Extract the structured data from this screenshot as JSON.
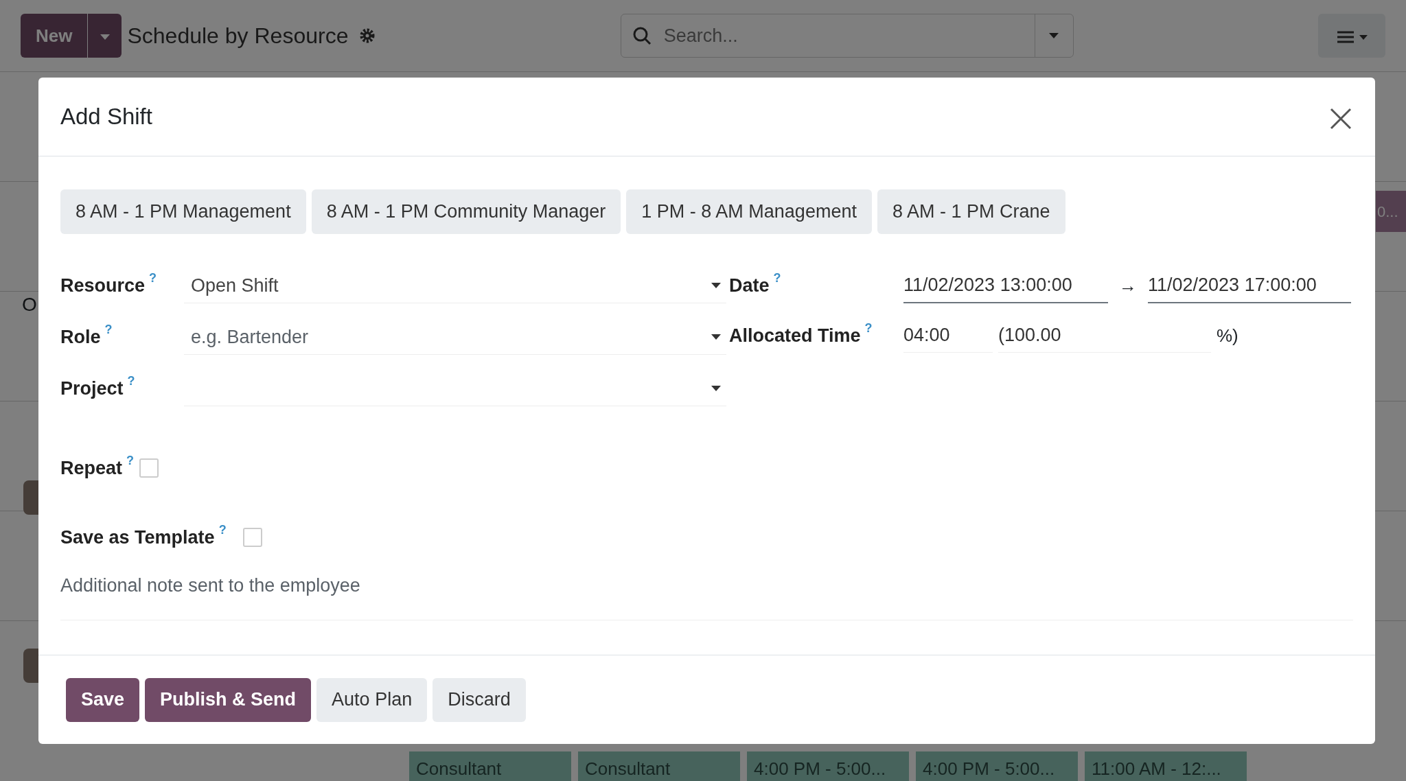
{
  "background": {
    "new_button": "New",
    "title": "Schedule by Resource",
    "search": {
      "placeholder": "Search..."
    },
    "row_label_fragment": "O",
    "pill_fragment": "0...",
    "bottom_shifts": [
      {
        "label": "Consultant"
      },
      {
        "label": "Consultant"
      },
      {
        "label": "4:00 PM - 5:00..."
      },
      {
        "label": "4:00 PM - 5:00..."
      },
      {
        "label": "11:00 AM - 12:..."
      }
    ]
  },
  "dialog": {
    "title": "Add Shift",
    "templates": [
      "8 AM - 1 PM Management",
      "8 AM - 1 PM Community Manager",
      "1 PM - 8 AM Management",
      "8 AM - 1 PM Crane"
    ],
    "left_fields": [
      {
        "label": "Resource",
        "help": "?",
        "kind": "select",
        "value": "Open Shift"
      },
      {
        "label": "Role",
        "help": "?",
        "kind": "select",
        "placeholder": "e.g. Bartender"
      },
      {
        "label": "Project",
        "help": "?",
        "kind": "select"
      }
    ],
    "date": {
      "label": "Date",
      "help": "?",
      "start": "11/02/2023 13:00:00",
      "separator": "→",
      "end": "11/02/2023 17:00:00"
    },
    "allocated_time": {
      "label": "Allocated Time",
      "help": "?",
      "hours": "04:00",
      "percent_open": "(100.00",
      "percent_close": "%)"
    },
    "repeat": {
      "label": "Repeat",
      "help": "?",
      "checked": false
    },
    "save_as_template": {
      "label": "Save as Template",
      "help": "?",
      "checked": false
    },
    "note": {
      "placeholder": "Additional note sent to the employee"
    },
    "buttons": [
      {
        "label": "Save",
        "kind": "primary"
      },
      {
        "label": "Publish & Send",
        "kind": "primary"
      },
      {
        "label": "Auto Plan",
        "kind": "secondary"
      },
      {
        "label": "Discard",
        "kind": "secondary"
      }
    ]
  }
}
